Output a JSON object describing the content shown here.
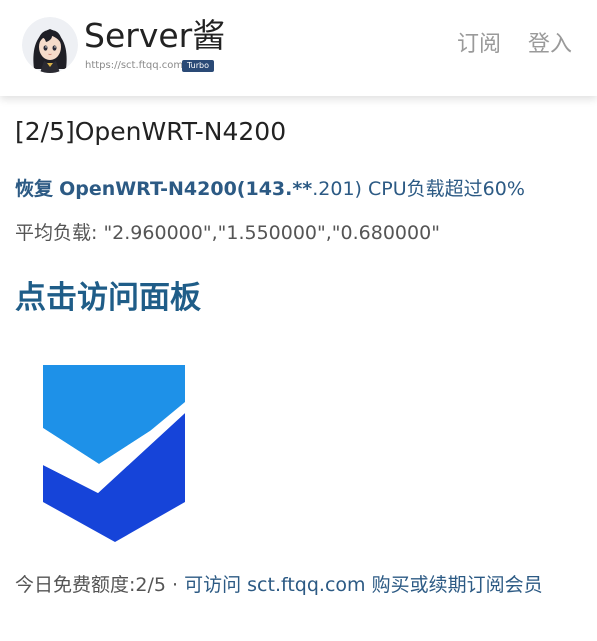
{
  "header": {
    "site_name": "Server酱",
    "site_url": "https://sct.ftqq.com",
    "badge": "Turbo",
    "nav": {
      "subscribe": "订阅",
      "login": "登入"
    }
  },
  "message": {
    "title": "[2/5]OpenWRT-N4200",
    "alert": {
      "status": "恢复",
      "host": "OpenWRT-N4200(143.",
      "masked": "**",
      "ip_tail": ".201)",
      "desc": " CPU负载超过60%"
    },
    "load_average": "平均负载: \"2.960000\",\"1.550000\",\"0.680000\""
  },
  "panel_link": "点击访问面板",
  "footer": {
    "quota": "今日免费额度:2/5 · ",
    "link": "可访问 sct.ftqq.com 购买或续期订阅会员"
  },
  "colors": {
    "logo_light": "#1e91e8",
    "logo_dark": "#1644d9",
    "link": "#1f5d88",
    "badge_bg": "#2a4a76"
  }
}
